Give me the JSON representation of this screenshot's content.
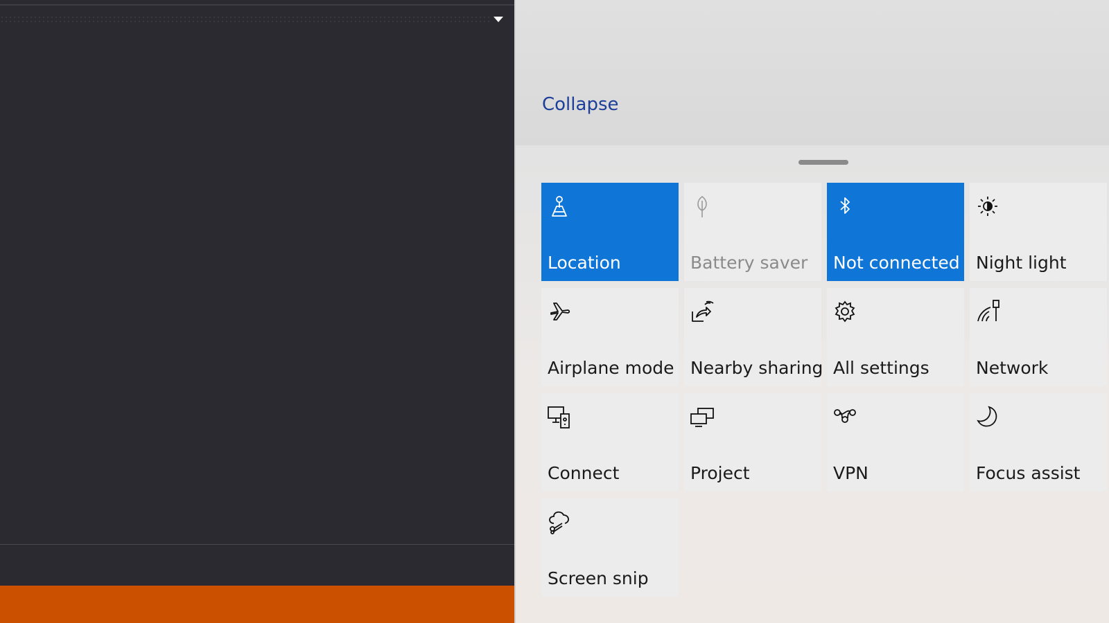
{
  "action_center": {
    "collapse_label": "Collapse",
    "accent_color": "#0f75d6",
    "tiles": [
      {
        "label": "Location",
        "icon": "location-icon",
        "state": "on"
      },
      {
        "label": "Battery saver",
        "icon": "battery-saver-icon",
        "state": "disabled"
      },
      {
        "label": "Not connected",
        "icon": "bluetooth-icon",
        "state": "on"
      },
      {
        "label": "Night light",
        "icon": "night-light-icon",
        "state": "off"
      },
      {
        "label": "Airplane mode",
        "icon": "airplane-icon",
        "state": "off"
      },
      {
        "label": "Nearby sharing",
        "icon": "nearby-sharing-icon",
        "state": "off"
      },
      {
        "label": "All settings",
        "icon": "gear-icon",
        "state": "off"
      },
      {
        "label": "Network",
        "icon": "network-icon",
        "state": "off"
      },
      {
        "label": "Connect",
        "icon": "connect-icon",
        "state": "off"
      },
      {
        "label": "Project",
        "icon": "project-icon",
        "state": "off"
      },
      {
        "label": "VPN",
        "icon": "vpn-icon",
        "state": "off"
      },
      {
        "label": "Focus assist",
        "icon": "moon-icon",
        "state": "off"
      },
      {
        "label": "Screen snip",
        "icon": "screen-snip-icon",
        "state": "off"
      }
    ]
  },
  "editor": {
    "status_bar_color": "#cb5100"
  }
}
